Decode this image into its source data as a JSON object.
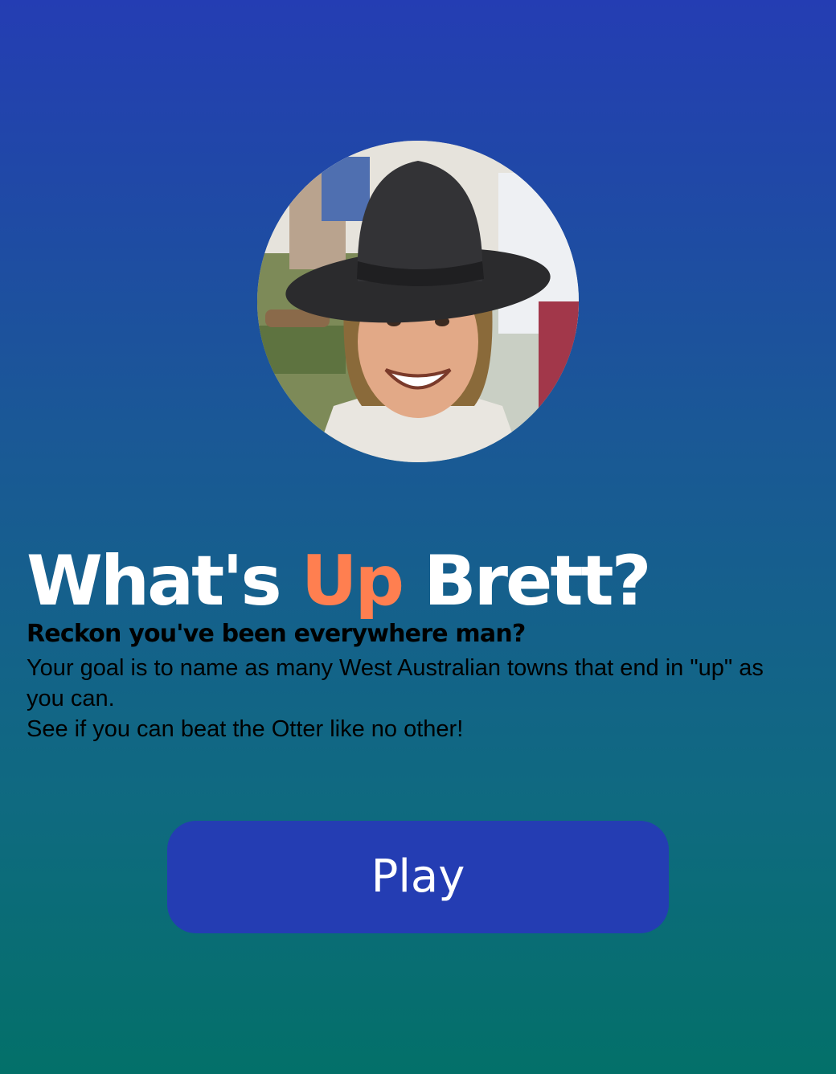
{
  "title": {
    "before": "What's",
    "accent": "Up",
    "after": "Brett?"
  },
  "subtitle": "Reckon you've been everywhere man?",
  "description": {
    "line1": "Your goal is to name as many West Australian towns that end in \"up\" as you can.",
    "line2": "See if you can beat the Otter like no other!"
  },
  "play_button": {
    "label": "Play"
  },
  "colors": {
    "background_top": "#243db3",
    "background_bottom": "#037069",
    "accent": "#ff7f50",
    "button": "#243db3"
  }
}
